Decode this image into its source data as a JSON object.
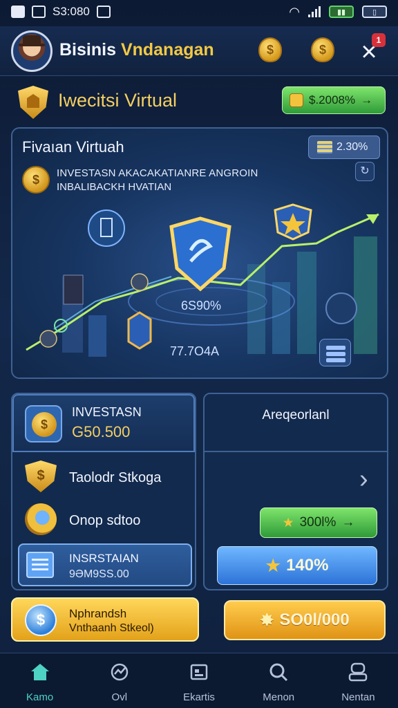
{
  "status_bar": {
    "time": "S3:080"
  },
  "header": {
    "title_part1": "Bisinis",
    "title_part2": "Vndanagan",
    "notification_count": "1"
  },
  "section": {
    "title": "Iweᴄitsi Virtual",
    "pill_value": "$.2008%"
  },
  "hero": {
    "title": "Fivaıan Virtuah",
    "badge": "2.30%",
    "line1": "INVESTASN AKACAKATIANRE ANGROIN",
    "line2": "INBALIBACKH HVATIAN",
    "percent": "6S90%",
    "value": "77.7O4A"
  },
  "left_panel": {
    "investment_label": "INVESTASN",
    "investment_value": "G50.500",
    "row1_label": "Taolodr Stkoga",
    "row2_label": "Onop sdtoo",
    "selected_label": "INSRSTAIAN",
    "selected_value": "9ƏM9SS.00"
  },
  "right_panel": {
    "title": "Areqeorlanl",
    "green_pill": "300l%",
    "blue_pill": "140%"
  },
  "actions": {
    "left_line1": "Nphrandsh",
    "left_line2": "Vnthaanh Stkeol)",
    "right_label": "SO0l/000"
  },
  "nav": [
    {
      "label": "Kamo"
    },
    {
      "label": "Ovl"
    },
    {
      "label": "Ekartis"
    },
    {
      "label": "Menon"
    },
    {
      "label": "Nentan"
    }
  ],
  "colors": {
    "accent_gold": "#f4cf62",
    "accent_green": "#2f9b39",
    "accent_blue": "#2c73d8",
    "nav_active": "#4ed2c4"
  }
}
